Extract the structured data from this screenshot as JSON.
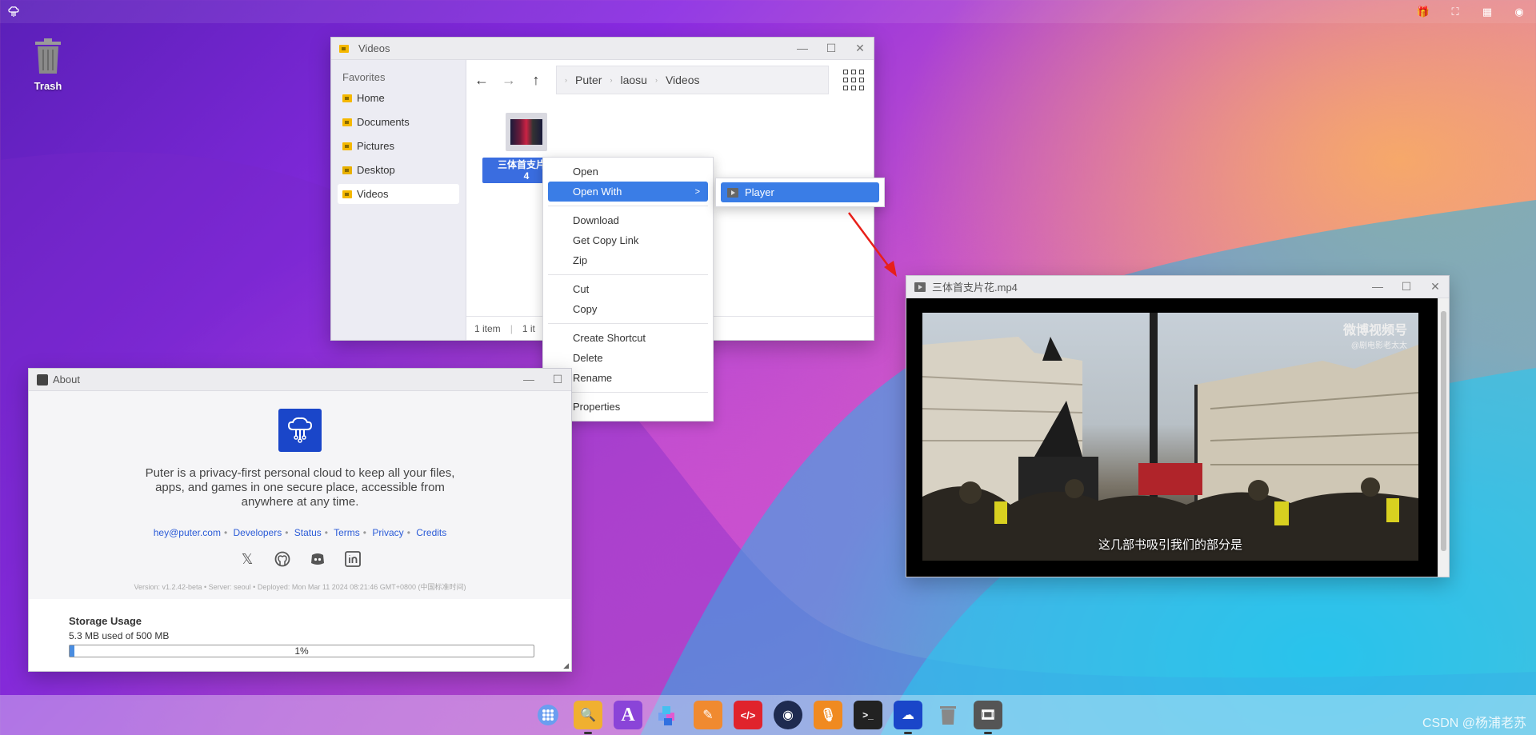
{
  "desktop": {
    "trash_label": "Trash",
    "watermark": "CSDN @杨浦老苏"
  },
  "explorer": {
    "title": "Videos",
    "sidebar_heading": "Favorites",
    "sidebar_items": [
      "Home",
      "Documents",
      "Pictures",
      "Desktop",
      "Videos"
    ],
    "breadcrumbs": [
      "Puter",
      "laosu",
      "Videos"
    ],
    "file_name": "三体首支片花.mp4",
    "file_name_shown": "三体首支片花\n4",
    "footer_count": "1 item",
    "footer_selected": "1 it"
  },
  "context_menu": {
    "items": [
      "Open",
      "Open With",
      "Download",
      "Get Copy Link",
      "Zip",
      "Cut",
      "Copy",
      "Create Shortcut",
      "Delete",
      "Rename",
      "Properties"
    ],
    "submenu_item": "Player"
  },
  "player": {
    "title": "三体首支片花.mp4",
    "subtitle": "这几部书吸引我们的部分是",
    "watermark_main": "微博视频号",
    "watermark_sub": "@剧电影老太太"
  },
  "about": {
    "title": "About",
    "description": "Puter is a privacy-first personal cloud to keep all your files, apps, and games in one secure place, accessible from anywhere at any time.",
    "links": [
      "hey@puter.com",
      "Developers",
      "Status",
      "Terms",
      "Privacy",
      "Credits"
    ],
    "version": "Version: v1.2.42-beta • Server: seoul • Deployed: Mon Mar 11 2024 08:21:46 GMT+0800 (中国标准时间)",
    "storage_heading": "Storage Usage",
    "storage_used": "5.3 MB used of 500 MB",
    "storage_percent_label": "1%",
    "storage_fraction": 0.01
  },
  "colors": {
    "accent": "#3a7de6",
    "puter_blue": "#1a46c9"
  }
}
